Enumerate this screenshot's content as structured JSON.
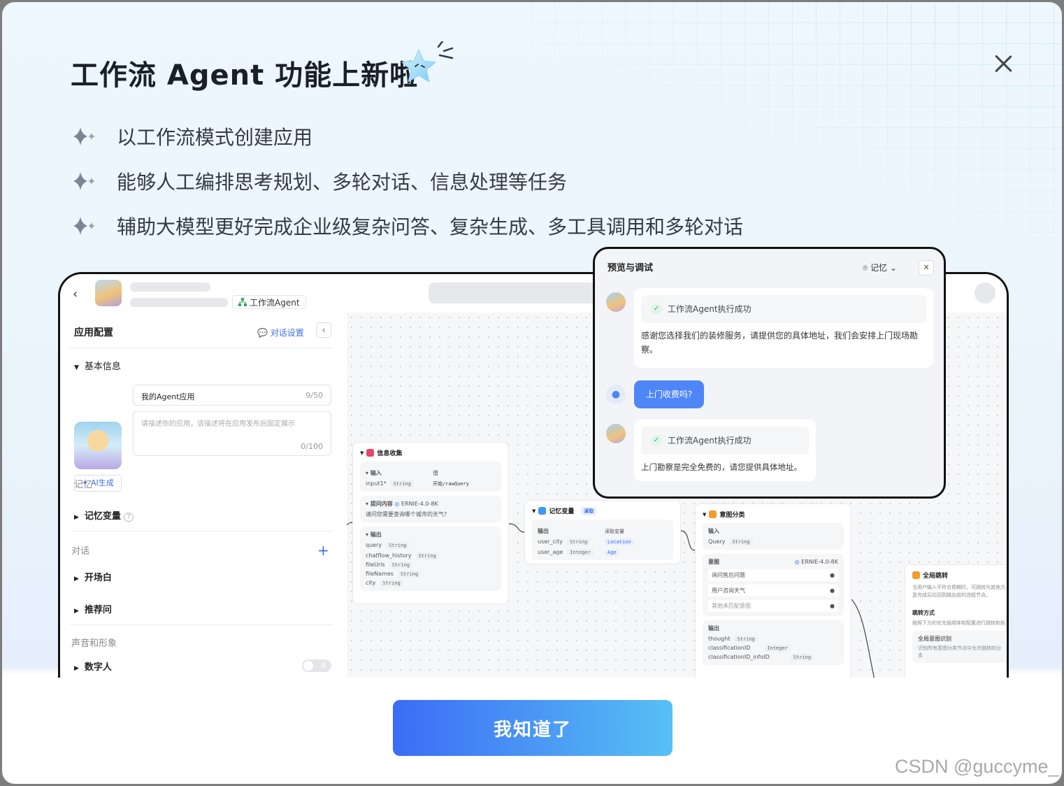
{
  "modal": {
    "title": "工作流 Agent 功能上新啦",
    "features": [
      "以工作流模式创建应用",
      "能够人工编排思考规划、多轮对话、信息处理等任务",
      "辅助大模型更好完成企业级复杂问答、复杂生成、多工具调用和多轮对话"
    ],
    "confirm_button": "我知道了",
    "watermark": "CSDN @guccyme_"
  },
  "preview": {
    "topbar": {
      "back_icon": "chevron-left-icon",
      "workflow_tag": "工作流Agent"
    },
    "left_panel": {
      "header": "应用配置",
      "dialog_settings_link": "对话设置",
      "basic_info": "基本信息",
      "app_name_value": "我的Agent应用",
      "app_name_count": "9/50",
      "desc_placeholder": "请描述你的应用，该描述将在应用发布后固定展示",
      "desc_count": "0/100",
      "ai_generate": "AI生成",
      "memory_section": "记忆",
      "memory_var": "记忆变量",
      "dialog_section": "对话",
      "opening": "开场白",
      "recommend": "推荐问",
      "voice_section": "声音和形象",
      "digital_human": "数字人",
      "toggle_off": "关"
    },
    "nodes": {
      "info": {
        "title": "信息收集",
        "input_label": "输入",
        "value_label": "值",
        "input_var": "input1*",
        "input_type": "String",
        "input_value": "开始/rawQuery",
        "ask_label": "提问内容",
        "ask_model": "ERNIE-4.0-8K",
        "ask_text": "请问您需要查询哪个城市的天气?",
        "output_label": "输出",
        "outputs": [
          {
            "name": "query",
            "type": "String"
          },
          {
            "name": "chatflow_history",
            "type": "String"
          },
          {
            "name": "fileUrls",
            "type": "String"
          },
          {
            "name": "fileNames",
            "type": "String"
          },
          {
            "name": "city",
            "type": "String"
          }
        ]
      },
      "memory": {
        "title": "记忆变量",
        "badge": "读取",
        "output_label": "输出",
        "read_label": "读取变量",
        "rows": [
          {
            "name": "user_city",
            "type": "String",
            "var": "Location"
          },
          {
            "name": "user_age",
            "type": "Integer",
            "var": "Age"
          }
        ]
      },
      "intent": {
        "title": "意图分类",
        "input_label": "输入",
        "input_var": "Query",
        "input_type": "String",
        "intent_label": "意图",
        "model": "ERNIE-4.0-8K",
        "intents": [
          "询问售后问题",
          "用户咨询天气",
          "其他未匹配意图"
        ],
        "output_label": "输出",
        "outputs": [
          {
            "name": "thought",
            "type": "String"
          },
          {
            "name": "classificationID",
            "type": "Integer"
          },
          {
            "name": "classificationID_infoID",
            "type": "String"
          }
        ]
      },
      "jump": {
        "title": "全局跳转",
        "desc": "当用户输入不符合预期时，可跳转为其他方复完成后拉回到跳出前的流程节点。",
        "mode_label": "跳转方式",
        "mode_desc": "按照下方的优先级顺序和配置进行跳转和执",
        "global_label": "全局意图识别",
        "global_desc": "识别所有意图分类节点中允许跳转的分支"
      }
    },
    "debug_panel": {
      "title": "预览与调试",
      "memory_label": "记忆",
      "success_text": "工作流Agent执行成功",
      "reply1": "感谢您选择我们的装修服务，请提供您的具体地址，我们会安排上门现场勘察。",
      "user_question": "上门收费吗?",
      "reply2": "上门勘察是完全免费的，请您提供具体地址。"
    }
  },
  "colors": {
    "accent": "#3b6cf0",
    "button_start": "#3b6cf5",
    "button_end": "#58c0f4",
    "user_bubble": "#4f86f7"
  }
}
